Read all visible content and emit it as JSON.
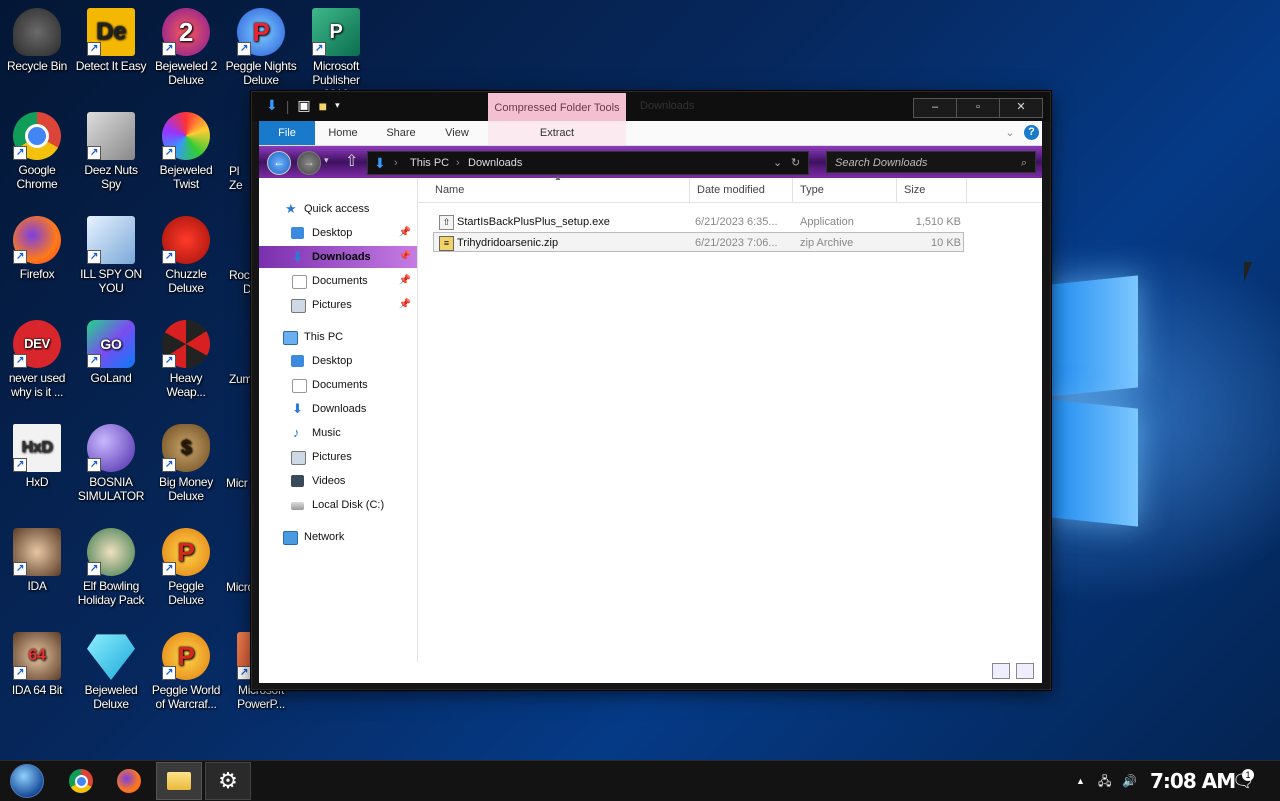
{
  "desktop": {
    "icons": [
      {
        "label": "Recycle Bin",
        "icon": "recycle-bin-icon"
      },
      {
        "label": "Detect It Easy",
        "icon": "die-icon"
      },
      {
        "label": "Bejeweled 2 Deluxe",
        "icon": "bejeweled2-icon"
      },
      {
        "label": "Peggle Nights Deluxe",
        "icon": "peggle-icon"
      },
      {
        "label": "Microsoft Publisher 2010",
        "icon": "publisher-icon"
      },
      {
        "label": "Google Chrome",
        "icon": "chrome-icon"
      },
      {
        "label": "Deez Nuts Spy",
        "icon": "window-stack-icon"
      },
      {
        "label": "Bejeweled Twist",
        "icon": "bejeweled-twist-icon"
      },
      {
        "label": "Firefox",
        "icon": "firefox-icon"
      },
      {
        "label": "ILL SPY ON YOU",
        "icon": "spy-icon"
      },
      {
        "label": "Chuzzle Deluxe",
        "icon": "chuzzle-icon"
      },
      {
        "label": "never used why is it ...",
        "icon": "devcpp-icon"
      },
      {
        "label": "GoLand",
        "icon": "goland-icon"
      },
      {
        "label": "Heavy Weap...",
        "icon": "radiation-icon"
      },
      {
        "label": "HxD",
        "icon": "hxd-icon"
      },
      {
        "label": "BOSNIA SIMULATOR",
        "icon": "mine-icon"
      },
      {
        "label": "Big Money Deluxe",
        "icon": "money-bag-icon"
      },
      {
        "label": "IDA",
        "icon": "ida-icon"
      },
      {
        "label": "Elf Bowling Holiday Pack",
        "icon": "elf-icon"
      },
      {
        "label": "Peggle Deluxe",
        "icon": "peggle-icon"
      },
      {
        "label": "IDA 64 Bit",
        "icon": "ida64-icon"
      },
      {
        "label": "Bejeweled Deluxe",
        "icon": "diamond-icon"
      },
      {
        "label": "Peggle World of Warcraf...",
        "icon": "peggle-icon"
      },
      {
        "label": "Microsoft PowerP...",
        "icon": "powerpoint-icon"
      }
    ],
    "partial_labels": [
      "Pl",
      "Ze",
      "Rocl",
      "D",
      "Zum",
      "Micr",
      "Micro"
    ]
  },
  "explorer": {
    "context_tab": "Compressed Folder Tools",
    "title": "Downloads",
    "ribbon_tabs": [
      "File",
      "Home",
      "Share",
      "View"
    ],
    "context_action": "Extract",
    "breadcrumb": [
      "This PC",
      "Downloads"
    ],
    "search_placeholder": "Search Downloads",
    "nav": {
      "quick_access": "Quick access",
      "quick_items": [
        "Desktop",
        "Downloads",
        "Documents",
        "Pictures"
      ],
      "this_pc": "This PC",
      "pc_items": [
        "Desktop",
        "Documents",
        "Downloads",
        "Music",
        "Pictures",
        "Videos",
        "Local Disk (C:)"
      ],
      "network": "Network"
    },
    "columns": [
      "Name",
      "Date modified",
      "Type",
      "Size"
    ],
    "files": [
      {
        "name": "StartIsBackPlusPlus_setup.exe",
        "date": "6/21/2023 6:35...",
        "type": "Application",
        "size": "1,510 KB"
      },
      {
        "name": "Trihydridoarsenic.zip",
        "date": "6/21/2023 7:06...",
        "type": "zip Archive",
        "size": "10 KB"
      }
    ]
  },
  "taskbar": {
    "clock": "7:08 AM",
    "notification_count": "1"
  }
}
